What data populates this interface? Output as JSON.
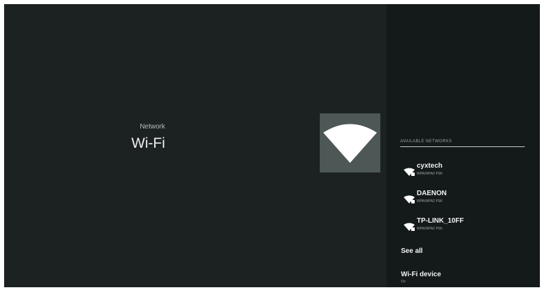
{
  "header": {
    "breadcrumb": "Network",
    "title": "Wi-Fi"
  },
  "tile": {
    "icon": "wifi-icon"
  },
  "networks_panel": {
    "section_title": "AVAILABLE NETWORKS",
    "networks": [
      {
        "name": "cyxtech",
        "security": "WPA/WPA2 PSK",
        "icon": "wifi-locked-icon"
      },
      {
        "name": "DAENON",
        "security": "WPA/WPA2 PSK",
        "icon": "wifi-locked-icon"
      },
      {
        "name": "TP-LINK_10FF",
        "security": "WPA/WPA2 PSK",
        "icon": "wifi-locked-icon"
      }
    ],
    "see_all": "See all",
    "wifi_device": {
      "label": "Wi-Fi device",
      "value": "On"
    }
  },
  "colors": {
    "background": "#1c2222",
    "panel": "#141a1a",
    "tile": "#4d5756",
    "text": "#f2f4f4"
  }
}
